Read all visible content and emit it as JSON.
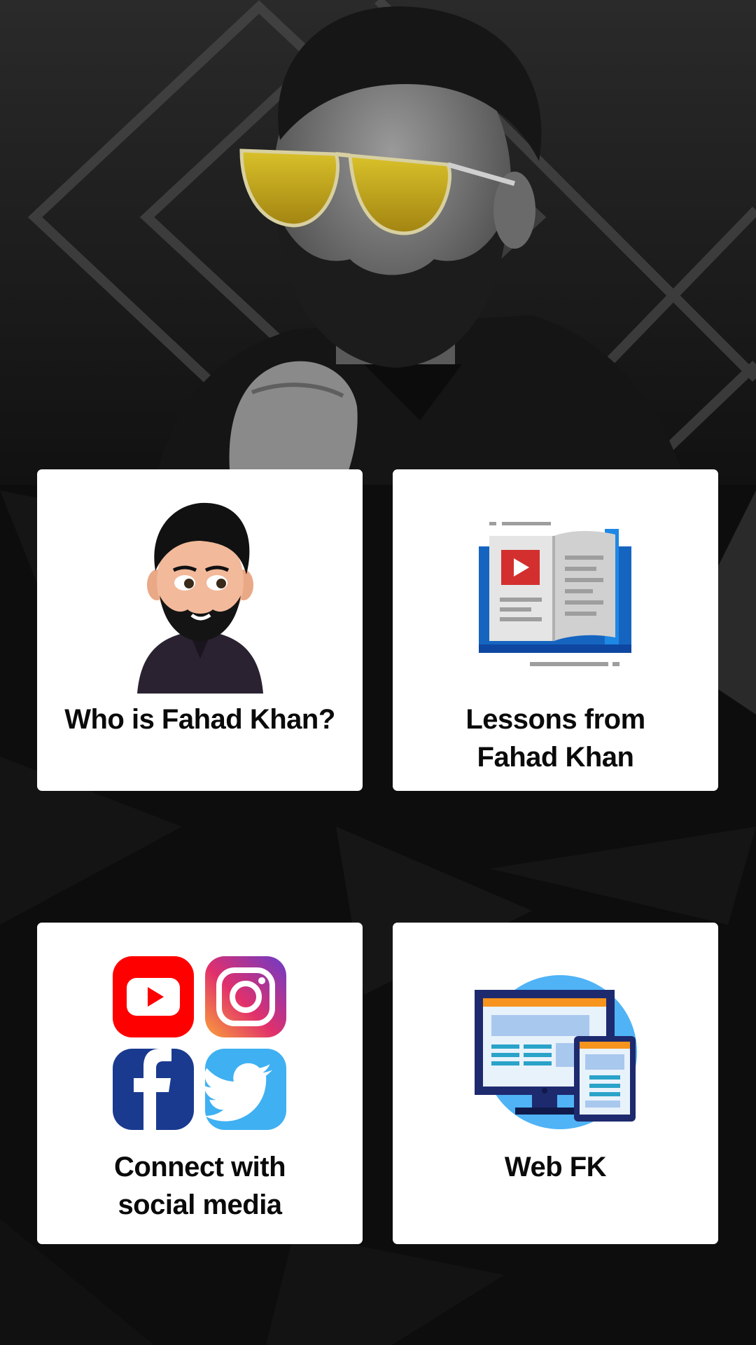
{
  "hero": {
    "icon": "profile-photo"
  },
  "cards": [
    {
      "label": "Who is Fahad Khan?",
      "icon": "avatar-cartoon-icon"
    },
    {
      "label": "Lessons from\nFahad Khan",
      "icon": "video-book-icon"
    },
    {
      "label": "Connect with\nsocial media",
      "icon": "social-media-icons"
    },
    {
      "label": "Web FK",
      "icon": "website-devices-icon"
    }
  ],
  "colors": {
    "background": "#0c0c0c",
    "card": "#ffffff",
    "text": "#0a0a0a",
    "youtube": "#ff0000",
    "facebook": "#1a3a8f",
    "twitter": "#3fb0f2",
    "book_blue": "#1565c0",
    "web_circle": "#4fb3f6",
    "web_orange": "#f7941d"
  }
}
